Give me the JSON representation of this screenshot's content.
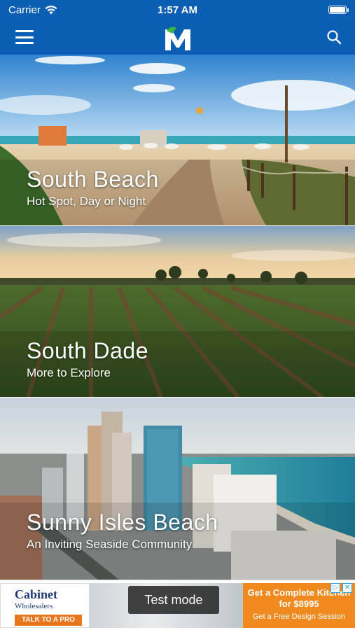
{
  "status_bar": {
    "carrier": "Carrier",
    "time": "1:57 AM",
    "battery_level": 1.0
  },
  "nav_bar": {
    "logo_text": "M",
    "menu_icon": "hamburger-menu-icon",
    "search_icon": "search-icon",
    "background_color": "#0a5fb4"
  },
  "cards": [
    {
      "title": "South Beach",
      "subtitle": "Hot Spot, Day or Night"
    },
    {
      "title": "South Dade",
      "subtitle": "More to Explore"
    },
    {
      "title": "Sunny Isles Beach",
      "subtitle": "An Inviting Seaside Community"
    }
  ],
  "ad": {
    "brand": "Cabinet",
    "brand_sub": "Wholesalers",
    "cta": "TALK TO A PRO",
    "test_label": "Test mode",
    "headline": "Get a Complete Kitchen for $8995",
    "subline": "Get a Free Design Session",
    "accent_color": "#f08a1e"
  }
}
